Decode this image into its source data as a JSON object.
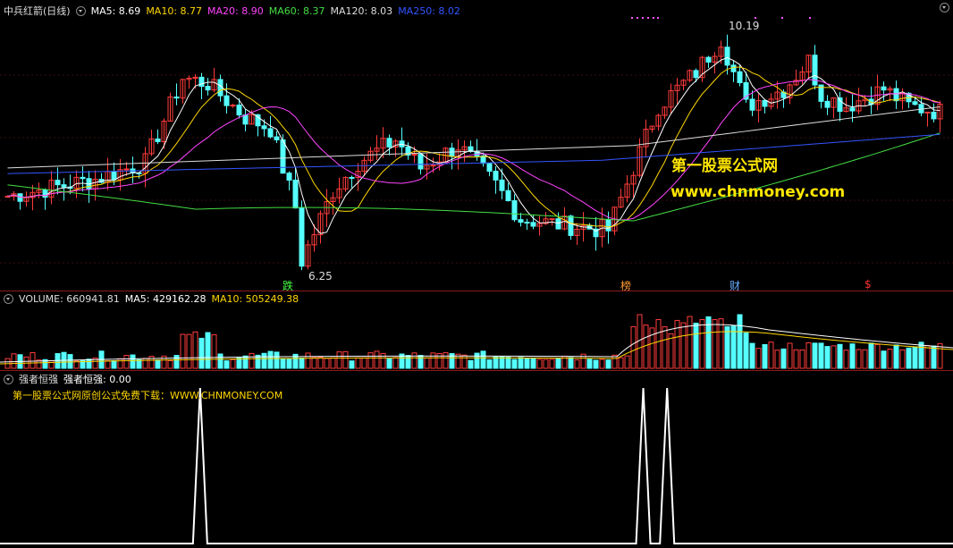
{
  "main": {
    "title": "中兵红箭(日线)",
    "ma": [
      {
        "label": "MA5: 8.69",
        "color": "#ffffff"
      },
      {
        "label": "MA10: 8.77",
        "color": "#ffd700"
      },
      {
        "label": "MA20: 8.90",
        "color": "#ff44ff"
      },
      {
        "label": "MA60: 8.37",
        "color": "#44dd44"
      },
      {
        "label": "MA120: 8.03",
        "color": "#dddddd"
      },
      {
        "label": "MA250: 8.02",
        "color": "#3355ff"
      }
    ],
    "high_label": "10.19",
    "low_label": "6.25",
    "tag_die": "跌",
    "tag_bang": "榜",
    "tag_cai": "财",
    "tag_dollar": "$",
    "watermark_cn": "第一股票公式网",
    "watermark_url": "www.chnmoney.com"
  },
  "volume": {
    "label_vol": "VOLUME: 660941.81",
    "label_ma5": "MA5: 429162.28",
    "label_ma10": "MA10: 505249.38"
  },
  "indicator": {
    "name": "强者恒强",
    "value": "强者恒强: 0.00",
    "promo": "第一股票公式网原创公式免费下载：WWW.CHNMONEY.COM"
  },
  "chart_data": {
    "type": "candlestick",
    "low_point": 6.25,
    "high_point": 10.19,
    "indicator_spikes_at": [
      0.21,
      0.675,
      0.7
    ]
  }
}
